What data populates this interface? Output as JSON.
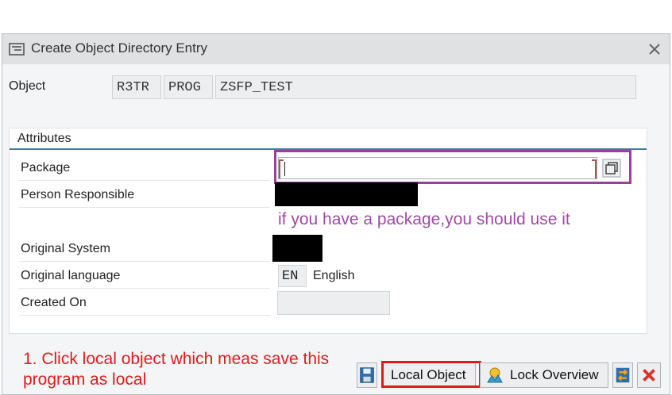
{
  "dialog": {
    "title": "Create Object Directory Entry"
  },
  "object": {
    "label": "Object",
    "pgmid": "R3TR",
    "type": "PROG",
    "name": "ZSFP_TEST"
  },
  "attributes": {
    "title": "Attributes",
    "package_label": "Package",
    "package_value": "",
    "person_label": "Person Responsible",
    "original_system_label": "Original System",
    "original_language_label": "Original language",
    "language_code": "EN",
    "language_name": "English",
    "created_on_label": "Created On"
  },
  "annotations": {
    "package_hint": "if you have a package,you should use it",
    "step1_line1": "1. Click local object which meas save this",
    "step1_line2": "program as local"
  },
  "buttons": {
    "local_object": "Local Object",
    "lock_overview": "Lock Overview"
  },
  "colors": {
    "annotation_purple": "#a04aa6",
    "annotation_red": "#e01b1b",
    "group_line": "#3c7f9a"
  }
}
